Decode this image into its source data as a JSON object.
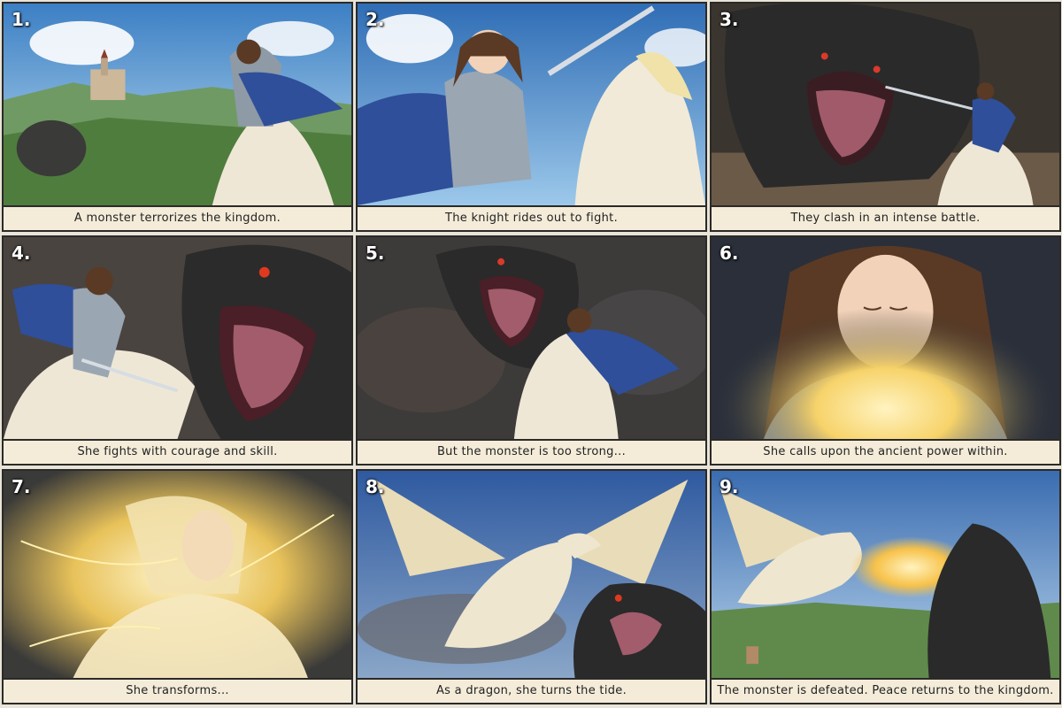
{
  "panels": [
    {
      "number": "1.",
      "caption": "A monster terrorizes the kingdom."
    },
    {
      "number": "2.",
      "caption": "The knight rides out to fight."
    },
    {
      "number": "3.",
      "caption": "They clash in an intense battle."
    },
    {
      "number": "4.",
      "caption": "She fights with courage and skill."
    },
    {
      "number": "5.",
      "caption": "But the monster is too strong..."
    },
    {
      "number": "6.",
      "caption": "She calls upon the ancient power within."
    },
    {
      "number": "7.",
      "caption": "She transforms..."
    },
    {
      "number": "8.",
      "caption": "As a dragon, she turns the tide."
    },
    {
      "number": "9.",
      "caption": "The monster is defeated. Peace returns to the kingdom."
    }
  ],
  "colors": {
    "caption_bg": "#f4ecd9",
    "border": "#2b2a28",
    "knight_cape": "#2f4f9a",
    "monster": "#2a2a2a",
    "magic_glow": "#f7d36a"
  }
}
